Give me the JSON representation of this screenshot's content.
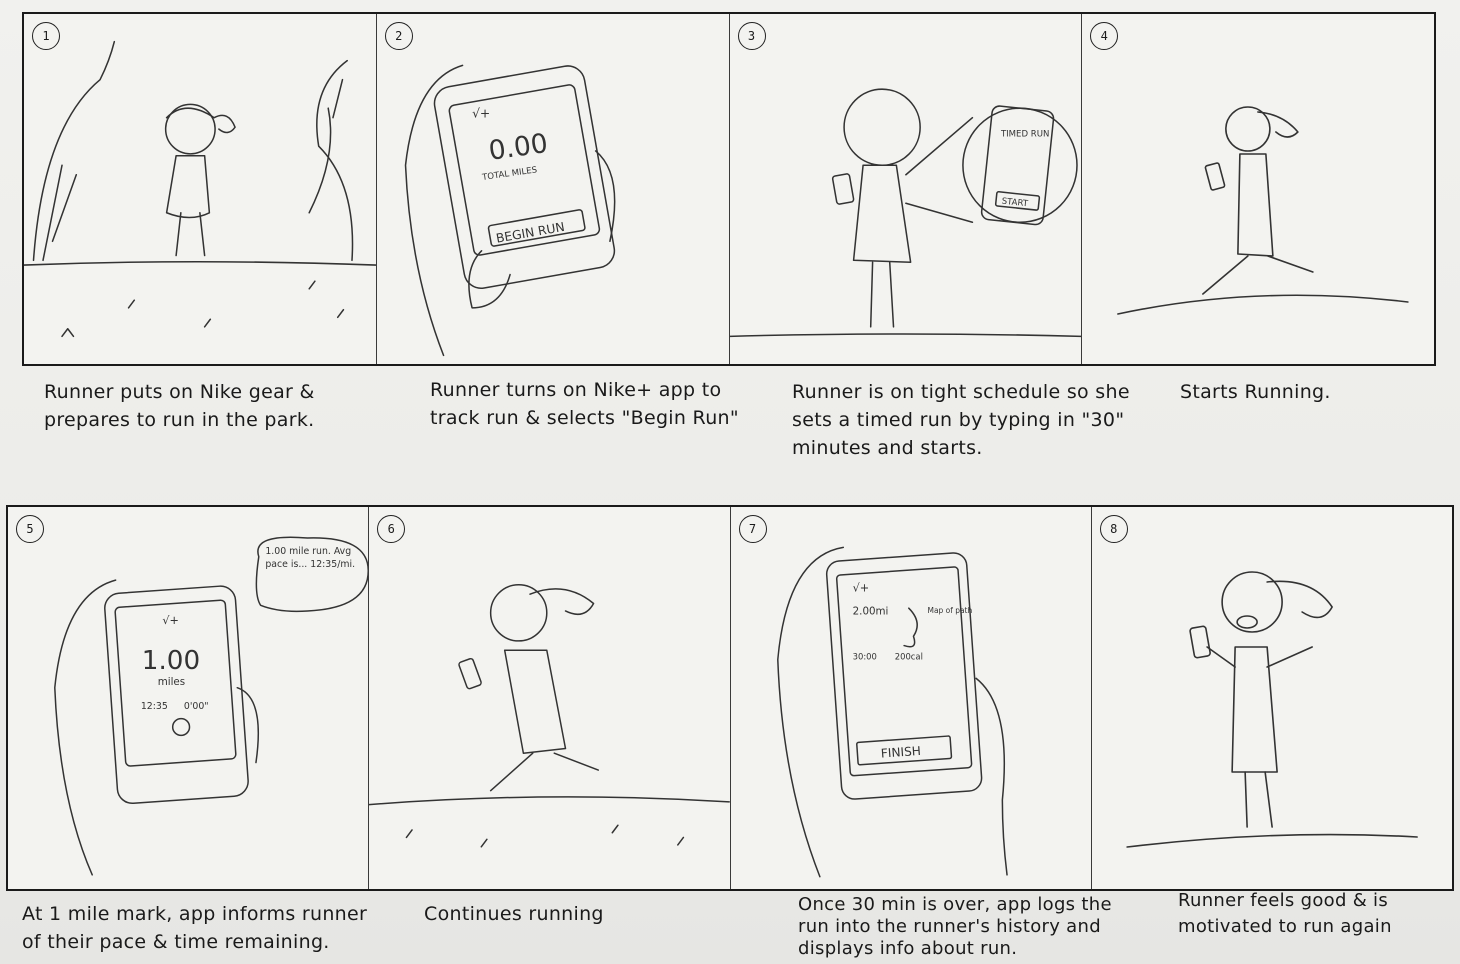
{
  "storyboard": {
    "panels": [
      {
        "number": "1",
        "caption": "Runner puts on Nike gear & prepares to run in the park."
      },
      {
        "number": "2",
        "caption": "Runner turns on Nike+ app to track run & selects \"Begin Run\"",
        "screen": {
          "brand": "√+",
          "value": "0.00",
          "unit": "TOTAL MILES",
          "button": "BEGIN RUN"
        }
      },
      {
        "number": "3",
        "caption": "Runner is on tight schedule so she sets a timed run by typing in \"30\" minutes and starts.",
        "screen": {
          "title": "TIMED RUN",
          "button": "START"
        }
      },
      {
        "number": "4",
        "caption": "Starts Running."
      },
      {
        "number": "5",
        "caption": "At 1 mile mark, app informs runner of their pace & time remaining.",
        "speech": "1.00 mile run. Avg pace is... 12:35/mi.",
        "screen": {
          "brand": "√+",
          "value": "1.00",
          "unit": "miles",
          "pace": "12:35",
          "time": "0'00\""
        }
      },
      {
        "number": "6",
        "caption": "Continues running"
      },
      {
        "number": "7",
        "caption": "Once 30 min is over, app logs the run into the runner's history and displays info about run.",
        "screen": {
          "brand": "√+",
          "distance": "2.00mi",
          "map_label": "Map of path",
          "duration": "30:00",
          "calories": "200cal",
          "button": "FINISH"
        }
      },
      {
        "number": "8",
        "caption": "Runner feels good & is motivated to run again"
      }
    ]
  }
}
